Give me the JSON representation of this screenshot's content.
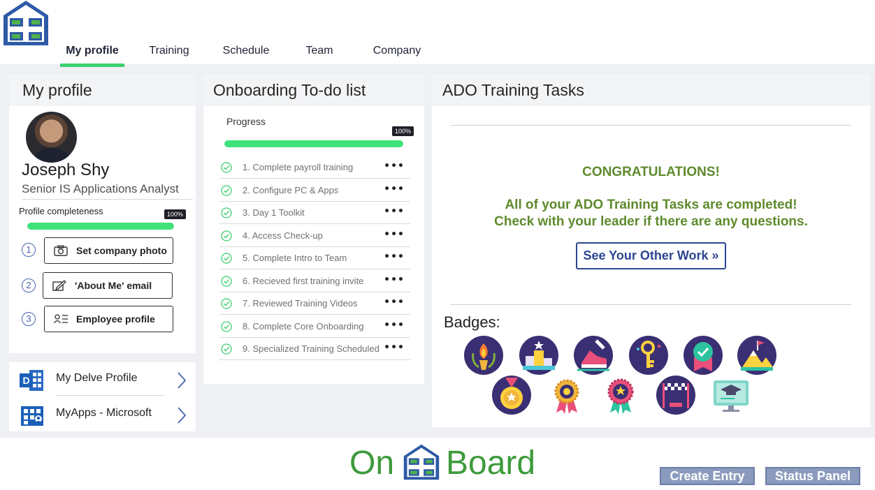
{
  "nav": {
    "tabs": [
      {
        "label": "My profile",
        "active": true
      },
      {
        "label": "Training",
        "active": false
      },
      {
        "label": "Schedule",
        "active": false
      },
      {
        "label": "Team",
        "active": false
      },
      {
        "label": "Company",
        "active": false
      }
    ]
  },
  "profile": {
    "heading": "My profile",
    "name": "Joseph Shy",
    "title": "Senior IS Applications Analyst",
    "completeness_label": "Profile completeness",
    "completeness_text": "100%",
    "completeness_value": 100,
    "steps": [
      {
        "num": "1",
        "label": "Set company photo",
        "icon": "camera-icon"
      },
      {
        "num": "2",
        "label": "'About Me' email",
        "icon": "edit-icon"
      },
      {
        "num": "3",
        "label": "Employee profile",
        "icon": "contact-card-icon"
      }
    ]
  },
  "links": [
    {
      "label": "My Delve Profile",
      "icon": "delve-icon"
    },
    {
      "label": "MyApps - Microsoft",
      "icon": "myapps-icon"
    }
  ],
  "todo": {
    "heading": "Onboarding To-do list",
    "progress_label": "Progress",
    "progress_text": "100%",
    "progress_value": 100,
    "items": [
      "1. Complete payroll training",
      "2. Configure PC & Apps",
      "3. Day 1 Toolkit",
      "4. Access Check-up",
      "5. Complete Intro to Team",
      "6. Recieved first training invite",
      "7. Reviewed Training Videos",
      "8. Complete Core Onboarding",
      "9. Specialized Training Scheduled"
    ],
    "more_glyph": "•••"
  },
  "ado": {
    "heading": "ADO Training Tasks",
    "congrats": "CONGRATULATIONS!",
    "message_line1": "All of your ADO Training Tasks are completed!",
    "message_line2": "Check with your leader if there are any questions.",
    "button_label": "See Your Other Work »",
    "badges_label": "Badges:",
    "badges": [
      "torch-badge",
      "podium-badge",
      "sneaker-badge",
      "key-badge",
      "certificate-badge",
      "mountain-flag-badge",
      "medal-badge",
      "rosette-badge",
      "star-rosette-badge",
      "finish-line-badge",
      "graduation-screen-badge"
    ]
  },
  "footer": {
    "brand_left": "On",
    "brand_right": "Board",
    "create_entry": "Create Entry",
    "status_panel": "Status Panel"
  },
  "colors": {
    "accent_green": "#3ecf6e",
    "progress_green": "#3ee27b",
    "message_green": "#5e8a2d",
    "brand_blue": "#2d4590",
    "footer_button": "#8b9bbd"
  }
}
